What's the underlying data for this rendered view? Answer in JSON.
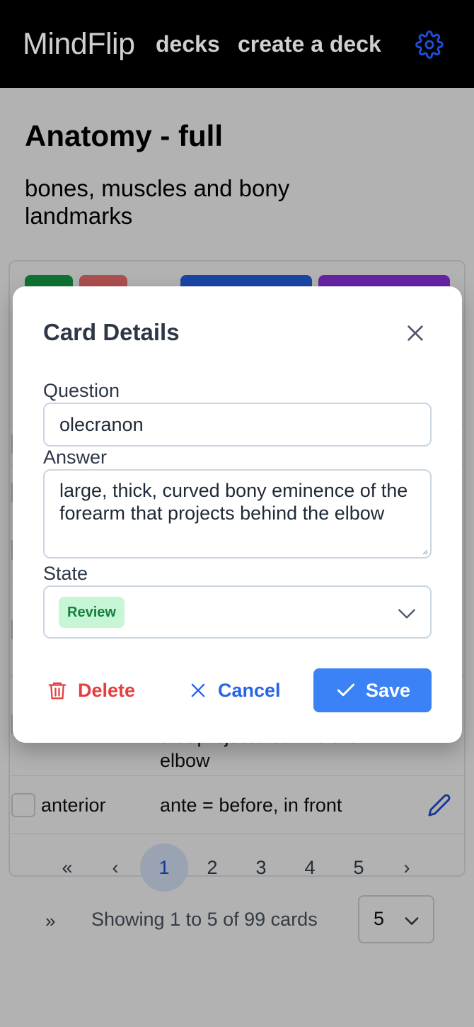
{
  "nav": {
    "brand_part1": "Mind",
    "brand_part2": "Flip",
    "decks": "decks",
    "create": "create a deck",
    "settings_icon": "gear-icon"
  },
  "deck": {
    "title": "Anatomy - full",
    "description": "bones, muscles and bony landmarks"
  },
  "background_rows": {
    "partial_answer_line1": "that projects behind the",
    "partial_answer_line2": "elbow",
    "row_question": "anterior",
    "row_answer": "ante = before, in front"
  },
  "pagination": {
    "first": "«",
    "prev": "‹",
    "pages": [
      "1",
      "2",
      "3",
      "4",
      "5"
    ],
    "active_page": "1",
    "next": "›",
    "last": "»",
    "showing": "Showing 1 to 5 of 99 cards",
    "per_page": "5"
  },
  "modal": {
    "title": "Card Details",
    "question_label": "Question",
    "question_value": "olecranon",
    "answer_label": "Answer",
    "answer_value": "large, thick, curved bony eminence of the forearm that projects behind the elbow",
    "state_label": "State",
    "state_value": "Review",
    "delete": "Delete",
    "cancel": "Cancel",
    "save": "Save"
  },
  "colors": {
    "accent": "#3b82f6",
    "danger": "#e53e3e",
    "badge_bg": "#c6f6d5",
    "badge_text": "#15803d"
  }
}
